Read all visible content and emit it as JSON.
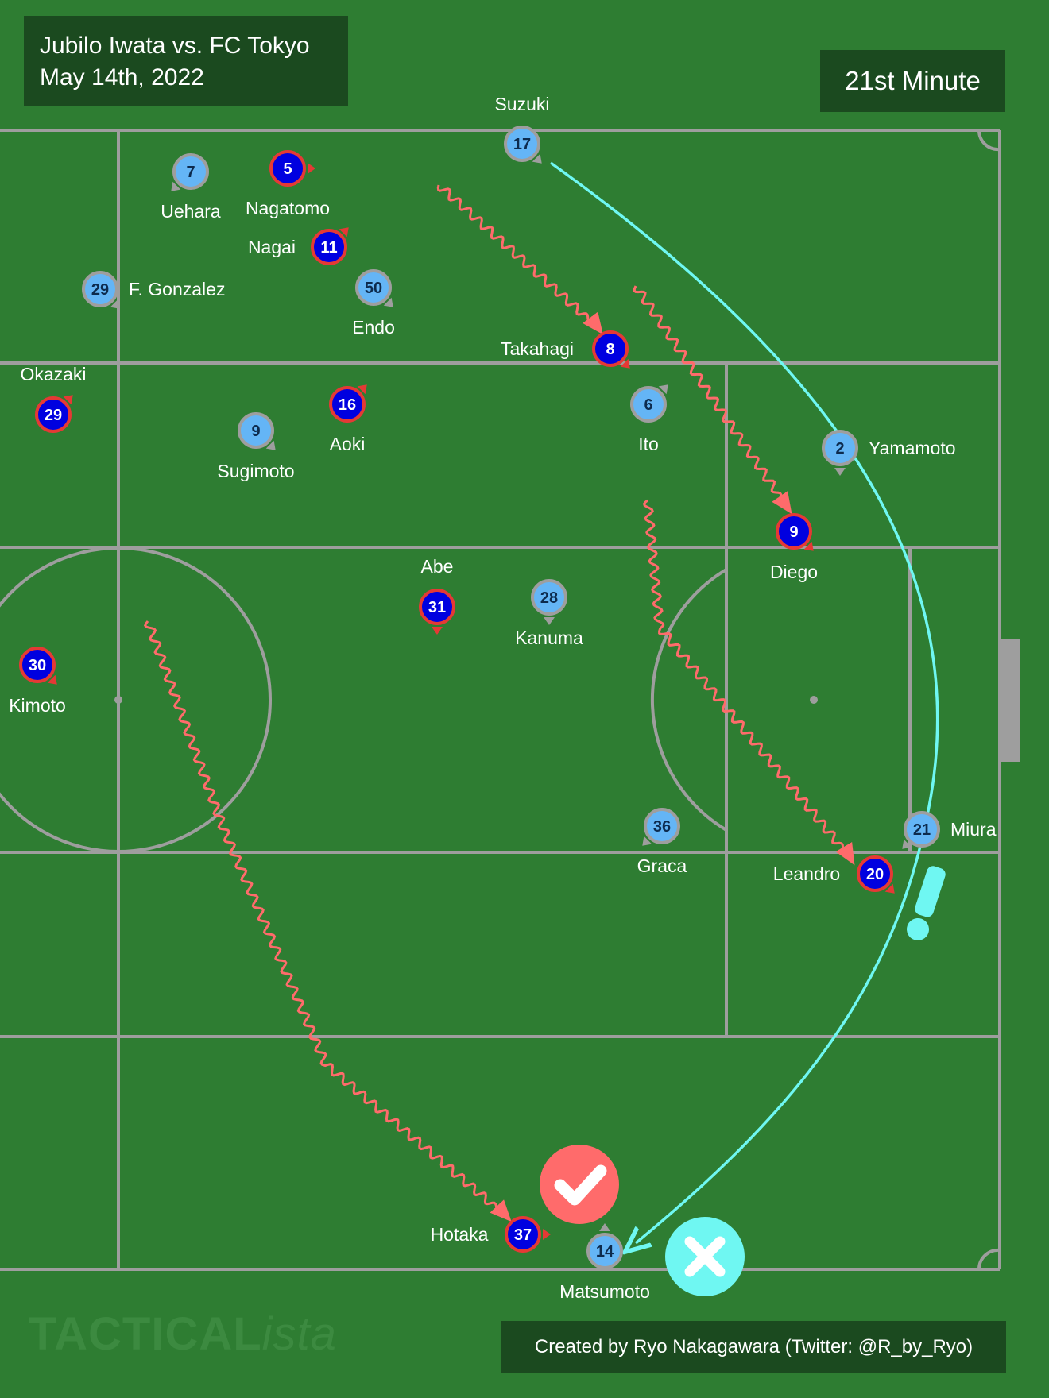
{
  "header": {
    "match": "Jubilo Iwata vs. FC Tokyo",
    "date": "May 14th, 2022"
  },
  "minute_label": "21st Minute",
  "credit": "Created by Ryo Nakagawara (Twitter: @R_by_Ryo)",
  "watermark": {
    "main": "TACTICAL",
    "suffix": "ista"
  },
  "colors": {
    "pitch": "#2e7d32",
    "line": "#9e9e9e",
    "box": "#1b4a1f",
    "home_fill": "#0000e0",
    "home_ring": "#e53935",
    "away_fill": "#64b5f6",
    "away_ring": "#9e9e9e",
    "run_arrow": "#ff6b6b",
    "pass_arrow": "#6ff7f2"
  },
  "players": [
    {
      "team": "away",
      "number": "17",
      "name": "Suzuki"
    },
    {
      "team": "away",
      "number": "7",
      "name": "Uehara"
    },
    {
      "team": "home",
      "number": "5",
      "name": "Nagatomo"
    },
    {
      "team": "home",
      "number": "11",
      "name": "Nagai"
    },
    {
      "team": "away",
      "number": "29",
      "name": "F. Gonzalez"
    },
    {
      "team": "away",
      "number": "50",
      "name": "Endo"
    },
    {
      "team": "home",
      "number": "8",
      "name": "Takahagi"
    },
    {
      "team": "home",
      "number": "29",
      "name": "Okazaki"
    },
    {
      "team": "home",
      "number": "16",
      "name": "Aoki"
    },
    {
      "team": "away",
      "number": "9",
      "name": "Sugimoto"
    },
    {
      "team": "away",
      "number": "6",
      "name": "Ito"
    },
    {
      "team": "away",
      "number": "2",
      "name": "Yamamoto"
    },
    {
      "team": "home",
      "number": "9",
      "name": "Diego"
    },
    {
      "team": "home",
      "number": "31",
      "name": "Abe"
    },
    {
      "team": "away",
      "number": "28",
      "name": "Kanuma"
    },
    {
      "team": "home",
      "number": "30",
      "name": "Kimoto"
    },
    {
      "team": "away",
      "number": "36",
      "name": "Graca"
    },
    {
      "team": "away",
      "number": "21",
      "name": "Miura"
    },
    {
      "team": "home",
      "number": "20",
      "name": "Leandro"
    },
    {
      "team": "home",
      "number": "37",
      "name": "Hotaka"
    },
    {
      "team": "away",
      "number": "14",
      "name": "Matsumoto"
    }
  ],
  "icons": {
    "check": "check-icon",
    "cross": "cross-icon",
    "exclamation": "exclamation-icon"
  }
}
